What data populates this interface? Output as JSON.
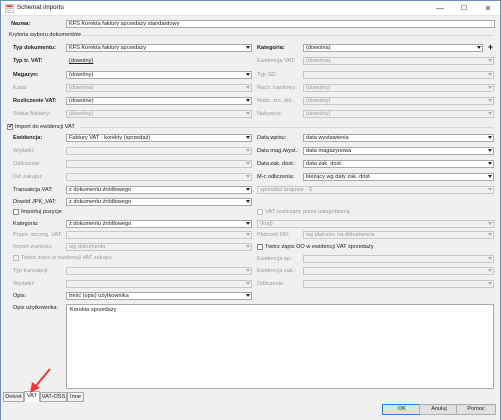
{
  "window": {
    "title": "Schemat importu",
    "minimize": "—",
    "maximize": "☐",
    "close": "✕"
  },
  "nazwa": {
    "label": "Nazwa:",
    "value": "KFS Korekta faktury sprzedaży standardowy"
  },
  "kryteria": {
    "header": "Kryteria wyboru dokumentów"
  },
  "left": {
    "typ_dokumentu": {
      "label": "Typ dokumentu:",
      "value": "KFS Korekta faktury sprzedaży"
    },
    "typ_tr_vat": {
      "label": "Typ tr. VAT:",
      "value": "(dowolny)"
    },
    "magazyn": {
      "label": "Magazyn:",
      "value": "(dowolny)"
    },
    "kasa": {
      "label": "Kasa:",
      "value": "(dowolna)"
    },
    "rozliczenie_vat": {
      "label": "Rozliczenie VAT:",
      "value": "(dowolne)"
    },
    "status_fiskalny": {
      "label": "Status fiskalny:",
      "value": "(dowolny)"
    }
  },
  "right": {
    "kategoria": {
      "label": "Kategoria:",
      "value": "(dowolna)"
    },
    "ewidencja_vat": {
      "label": "Ewidencja VAT:",
      "value": "(dowolna)"
    },
    "typ_sd": {
      "label": "Typ ŚD:",
      "value": ""
    },
    "rach_bankowy": {
      "label": "Rach. bankowy:",
      "value": "(dowolny)"
    },
    "rodz_zrc_del": {
      "label": "Rodz. zrc. del.:",
      "value": "(dowolny)"
    },
    "nabywca": {
      "label": "Nabywca:",
      "value": "(dowolny)"
    }
  },
  "import_vat": {
    "label": "Import do ewidencji VAT"
  },
  "ewidencja": {
    "ewidencja": {
      "label": "Ewidencja:",
      "value": "Faktury VAT - korekty (sprzedaż)"
    },
    "wydatki": {
      "label": "Wydatki:",
      "value": ""
    },
    "odliczenie": {
      "label": "Odliczenie:",
      "value": ""
    },
    "cel_zakupu": {
      "label": "Cel zakupu:",
      "value": ""
    },
    "transakcja_vat": {
      "label": "Transakcja VAT:",
      "value": "z dokumentu źródłowego"
    },
    "dowod_jpk": {
      "label": "Dowód JPK_VAT:",
      "value": "z dokumentu źródłowego"
    },
    "importuj_pozycje": {
      "label": "Importuj pozycje"
    },
    "kategoria": {
      "label": "Kategoria:",
      "value": "z dokumentu źródłowego"
    },
    "przen_szczeg": {
      "label": "Przen. szczeg. VAT:",
      "value": ""
    },
    "import_wartosci": {
      "label": "Import wartości:",
      "value": "wg dokumentu"
    },
    "tworz_zapis": {
      "label": "Twórz zapis w ewidencji VAT zakupu"
    },
    "typ_transakcji": {
      "label": "Typ transakcji:",
      "value": ""
    },
    "wydatki2": {
      "label": "Wydatki:",
      "value": ""
    },
    "opis": {
      "label": "Opis:",
      "value": "treść (opis) użytkownika"
    },
    "opis_uzytkownika": {
      "label": "Opis użytkownika:",
      "value": "Korekta sprzedaży"
    }
  },
  "ewidencja_right": {
    "data_wpisu": {
      "label": "Data wpisu:",
      "value": "data wystawienia"
    },
    "data_mag": {
      "label": "Data mag./wyst.:",
      "value": "data magazynowa"
    },
    "data_zak": {
      "label": "Data zak. dost.:",
      "value": "data zak. dost."
    },
    "m_c_odliczenia": {
      "label": "M-c odliczenia:",
      "value": "bieżący wg daty zak. dost."
    },
    "sprzedaz": {
      "value": "sprzedaż krajowa - S"
    },
    "vat_rozliczany": {
      "label": "VAT rozliczany przez usługobiorcę"
    },
    "kraj": {
      "value": "(kraj)"
    },
    "platnik": {
      "label": "Płatność RR:",
      "value": "wg platnosc na dokumencie"
    },
    "tworz_zapis_oo": {
      "label": "Twórz zapis OO w ewidencji VAT sprzedaży"
    },
    "ewidencja_op": {
      "label": "Ewidencja op.:",
      "value": ""
    },
    "ewidencja_zak": {
      "label": "Ewidencja zak.:",
      "value": ""
    },
    "odliczenie2": {
      "label": "Odliczenie:",
      "value": ""
    }
  },
  "tabs": [
    "Dekret",
    "VAT",
    "VAT-OSS",
    "Inne"
  ],
  "buttons": {
    "ok": "OK",
    "cancel": "Anuluj",
    "help": "Pomoc"
  },
  "colors": {
    "accent": "#2f7bd9",
    "arrow": "#e53935",
    "title_icon": "#d9342b"
  },
  "icons": {
    "app": "form-icon",
    "plus": "plus-icon"
  }
}
